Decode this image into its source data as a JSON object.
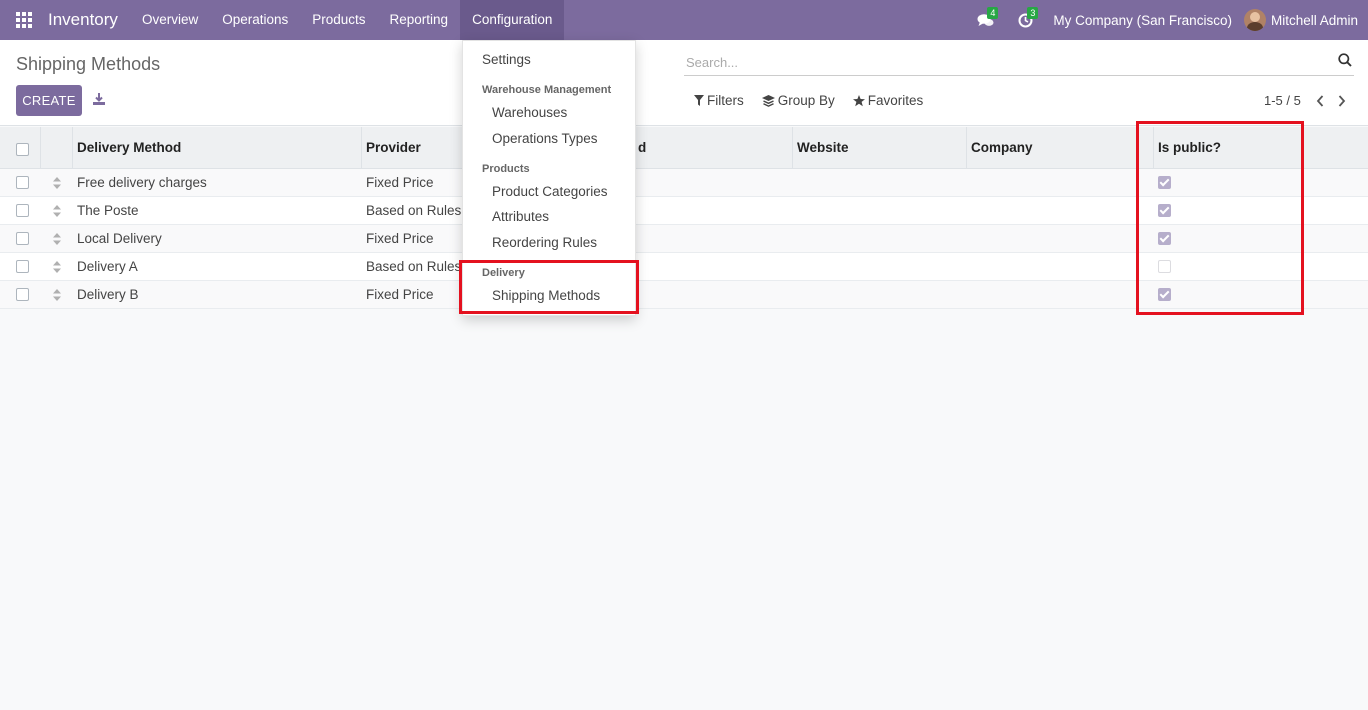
{
  "navbar": {
    "app_name": "Inventory",
    "menu": [
      "Overview",
      "Operations",
      "Products",
      "Reporting",
      "Configuration"
    ],
    "active_menu": "Configuration",
    "messages_count": "4",
    "activities_count": "3",
    "company": "My Company (San Francisco)",
    "user": "Mitchell Admin"
  },
  "control": {
    "title": "Shipping Methods",
    "create_label": "CREATE",
    "search_placeholder": "Search...",
    "filters_label": "Filters",
    "group_by_label": "Group By",
    "favorites_label": "Favorites",
    "pager": "1-5 / 5"
  },
  "table": {
    "headers": {
      "delivery_method": "Delivery Method",
      "provider": "Provider",
      "hidden_partial": "d",
      "website": "Website",
      "company": "Company",
      "is_public": "Is public?"
    },
    "rows": [
      {
        "name": "Free delivery charges",
        "provider": "Fixed Price",
        "is_public": true
      },
      {
        "name": "The Poste",
        "provider": "Based on Rules",
        "is_public": true
      },
      {
        "name": "Local Delivery",
        "provider": "Fixed Price",
        "is_public": true
      },
      {
        "name": "Delivery A",
        "provider": "Based on Rules",
        "is_public": false
      },
      {
        "name": "Delivery B",
        "provider": "Fixed Price",
        "is_public": true
      }
    ]
  },
  "dropdown": {
    "settings": "Settings",
    "warehouse_header": "Warehouse Management",
    "warehouses": "Warehouses",
    "operation_types": "Operations Types",
    "products_header": "Products",
    "product_categories": "Product Categories",
    "attributes": "Attributes",
    "reordering_rules": "Reordering Rules",
    "delivery_header": "Delivery",
    "shipping_methods": "Shipping Methods"
  },
  "colors": {
    "brand": "#7c6b9e",
    "highlight": "#e4111f",
    "badge": "#28a745"
  }
}
